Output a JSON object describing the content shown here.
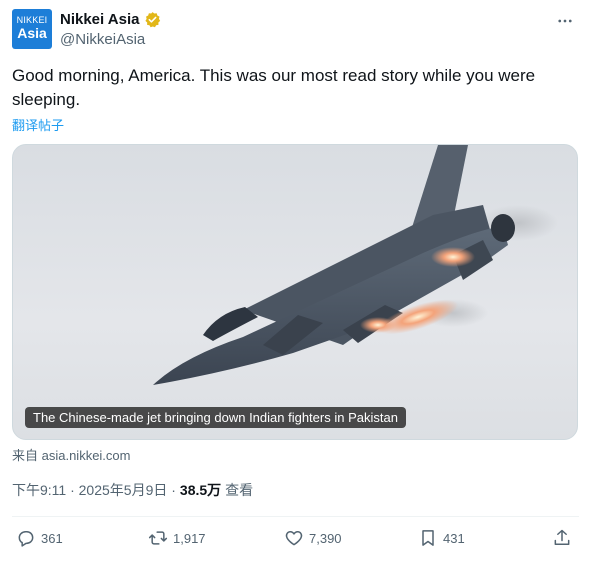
{
  "account": {
    "avatar_line1": "NIKKEI",
    "avatar_line2": "Asia",
    "display_name": "Nikkei Asia",
    "handle": "@NikkeiAsia",
    "verified": true
  },
  "tweet": {
    "text": "Good morning, America. This was our most read story while you were sleeping.",
    "translate_label": "翻译帖子"
  },
  "card": {
    "caption": "The Chinese-made jet bringing down Indian fighters in Pakistan",
    "source": "来自 asia.nikkei.com"
  },
  "meta": {
    "timestamp": "下午9:11 · 2025年5月9日 ·",
    "views": "38.5万",
    "views_label": "查看"
  },
  "actions": {
    "reply_count": "361",
    "retweet_count": "1,917",
    "like_count": "7,390",
    "bookmark_count": "431"
  },
  "icons": {
    "verified": "verified-badge-icon",
    "more": "more-dots-icon",
    "reply": "reply-icon",
    "retweet": "retweet-icon",
    "like": "heart-icon",
    "bookmark": "bookmark-icon",
    "share": "share-icon"
  },
  "colors": {
    "brand_blue": "#1d7ed8",
    "link_blue": "#1d9bf0",
    "verified_gold": "#e2b719",
    "muted_text": "#536471"
  }
}
